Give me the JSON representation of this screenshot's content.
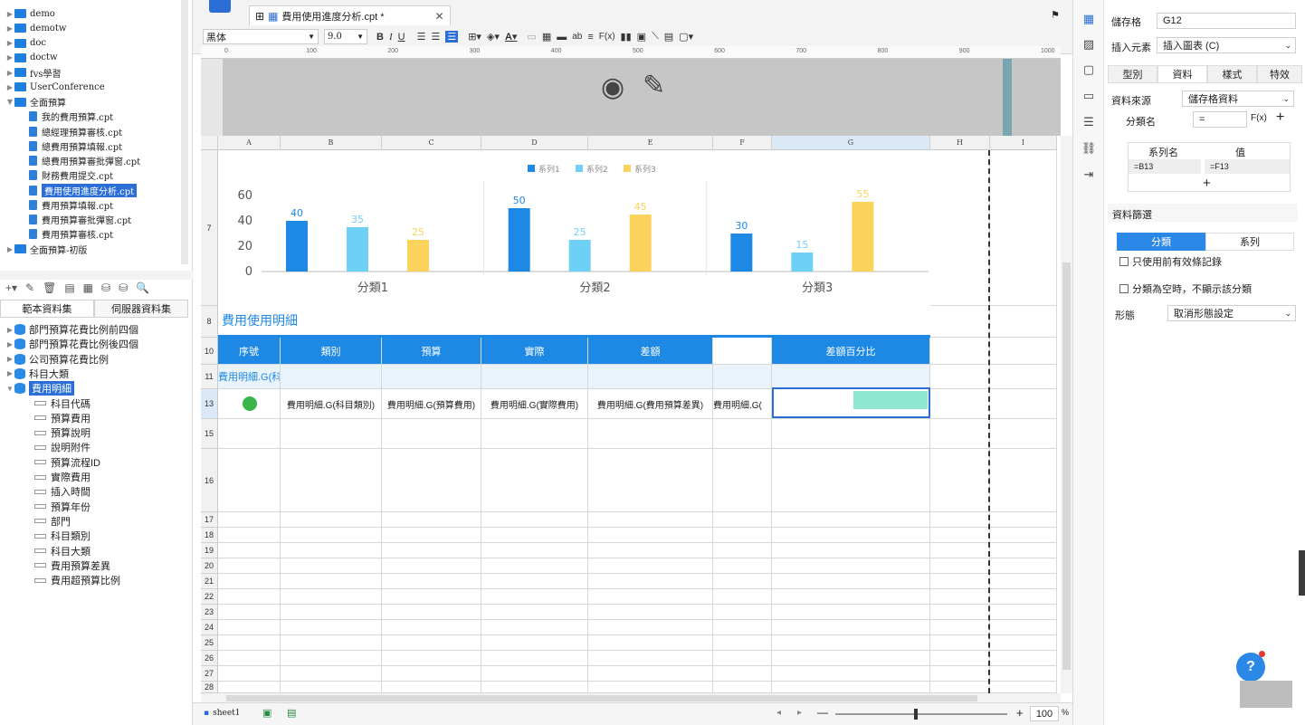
{
  "left_tree": {
    "items": [
      {
        "label": "demo",
        "type": "folder"
      },
      {
        "label": "demotw",
        "type": "folder"
      },
      {
        "label": "doc",
        "type": "folder"
      },
      {
        "label": "doctw",
        "type": "folder"
      },
      {
        "label": "fvs學習",
        "type": "folder"
      },
      {
        "label": "UserConference",
        "type": "folder"
      },
      {
        "label": "全面預算",
        "type": "folder-open"
      },
      {
        "label": "我的費用預算.cpt",
        "type": "file"
      },
      {
        "label": "總經理預算審核.cpt",
        "type": "file"
      },
      {
        "label": "總費用預算填報.cpt",
        "type": "file"
      },
      {
        "label": "總費用預算審批彈窗.cpt",
        "type": "file"
      },
      {
        "label": "財務費用提交.cpt",
        "type": "file"
      },
      {
        "label": "費用使用進度分析.cpt",
        "type": "file-selected"
      },
      {
        "label": "費用預算填報.cpt",
        "type": "file"
      },
      {
        "label": "費用預算審批彈窗.cpt",
        "type": "file"
      },
      {
        "label": "費用預算審核.cpt",
        "type": "file"
      },
      {
        "label": "全面預算-初版",
        "type": "folder"
      }
    ]
  },
  "dataset_tabs": {
    "template": "範本資料集",
    "server": "伺服器資料集"
  },
  "datasets": {
    "items": [
      {
        "label": "部門預算花費比例前四個",
        "type": "db"
      },
      {
        "label": "部門預算花費比例後四個",
        "type": "db"
      },
      {
        "label": "公司預算花費比例",
        "type": "db"
      },
      {
        "label": "科目大類",
        "type": "db"
      },
      {
        "label": "費用明細",
        "type": "db-selected"
      },
      {
        "label": "科目代碼",
        "type": "field"
      },
      {
        "label": "預算費用",
        "type": "field"
      },
      {
        "label": "預算說明",
        "type": "field"
      },
      {
        "label": "說明附件",
        "type": "field"
      },
      {
        "label": "預算流程ID",
        "type": "field"
      },
      {
        "label": "實際費用",
        "type": "field"
      },
      {
        "label": "插入時間",
        "type": "field"
      },
      {
        "label": "預算年份",
        "type": "field"
      },
      {
        "label": "部門",
        "type": "field"
      },
      {
        "label": "科目類別",
        "type": "field"
      },
      {
        "label": "科目大類",
        "type": "field"
      },
      {
        "label": "費用預算差異",
        "type": "field"
      },
      {
        "label": "費用超預算比例",
        "type": "field"
      }
    ]
  },
  "editor_tab": {
    "title": "費用使用進度分析.cpt *"
  },
  "toolbar": {
    "font": "黑体",
    "size": "9.0"
  },
  "ruler": [
    "0",
    "100",
    "200",
    "300",
    "400",
    "500",
    "600",
    "700",
    "800",
    "900",
    "1000"
  ],
  "sheet": {
    "columns": [
      "A",
      "B",
      "C",
      "D",
      "E",
      "F",
      "G",
      "H",
      "I"
    ],
    "rows": [
      "7",
      "8",
      "10",
      "11",
      "13",
      "15",
      "16",
      "17",
      "18",
      "19",
      "20",
      "21",
      "22",
      "23",
      "24",
      "25",
      "26",
      "27",
      "28"
    ],
    "section_title": "費用使用明細",
    "headers": [
      "序號",
      "類別",
      "預算",
      "實際",
      "差額",
      "",
      "差額百分比"
    ],
    "row11_text": "費用明細.G(科目大類)",
    "row13": [
      "",
      "費用明細.G(科目類別)",
      "費用明細.G(預算費用)",
      "費用明細.G(實際費用)",
      "費用明細.G(費用預算差異)",
      "費用明細.G(",
      ""
    ]
  },
  "chart_data": {
    "type": "bar",
    "categories": [
      "分類1",
      "分類2",
      "分類3"
    ],
    "series": [
      {
        "name": "系列1",
        "values": [
          40,
          50,
          30
        ],
        "color": "#1e88e5"
      },
      {
        "name": "系列2",
        "values": [
          35,
          25,
          15
        ],
        "color": "#6fd0f5"
      },
      {
        "name": "系列3",
        "values": [
          25,
          45,
          55
        ],
        "color": "#fbd25c"
      }
    ],
    "ylim": [
      0,
      60
    ],
    "yticks": [
      "0",
      "20",
      "40",
      "60"
    ],
    "legend": "top-center"
  },
  "right_panel": {
    "cell_label": "儲存格",
    "cell_value": "G12",
    "insert_label": "插入元素",
    "insert_value": "插入圖表 (C)",
    "tabs": [
      "型別",
      "資料",
      "樣式",
      "特效"
    ],
    "source_label": "資料來源",
    "source_value": "儲存格資料",
    "category_label": "分類名",
    "category_value": "=",
    "series_name_hdr": "系列名",
    "value_hdr": "值",
    "series_name": "=B13",
    "series_value": "=F13",
    "filter_label": "資料篩選",
    "filter_tabs": [
      "分類",
      "系列"
    ],
    "check1": "只使用前有效條記錄",
    "check2": "分類為空時，不顯示該分類",
    "shape_label": "形態",
    "shape_value": "取消形態設定"
  },
  "bottom": {
    "sheet": "sheet1",
    "zoom": "100",
    "zoom_unit": "%"
  }
}
